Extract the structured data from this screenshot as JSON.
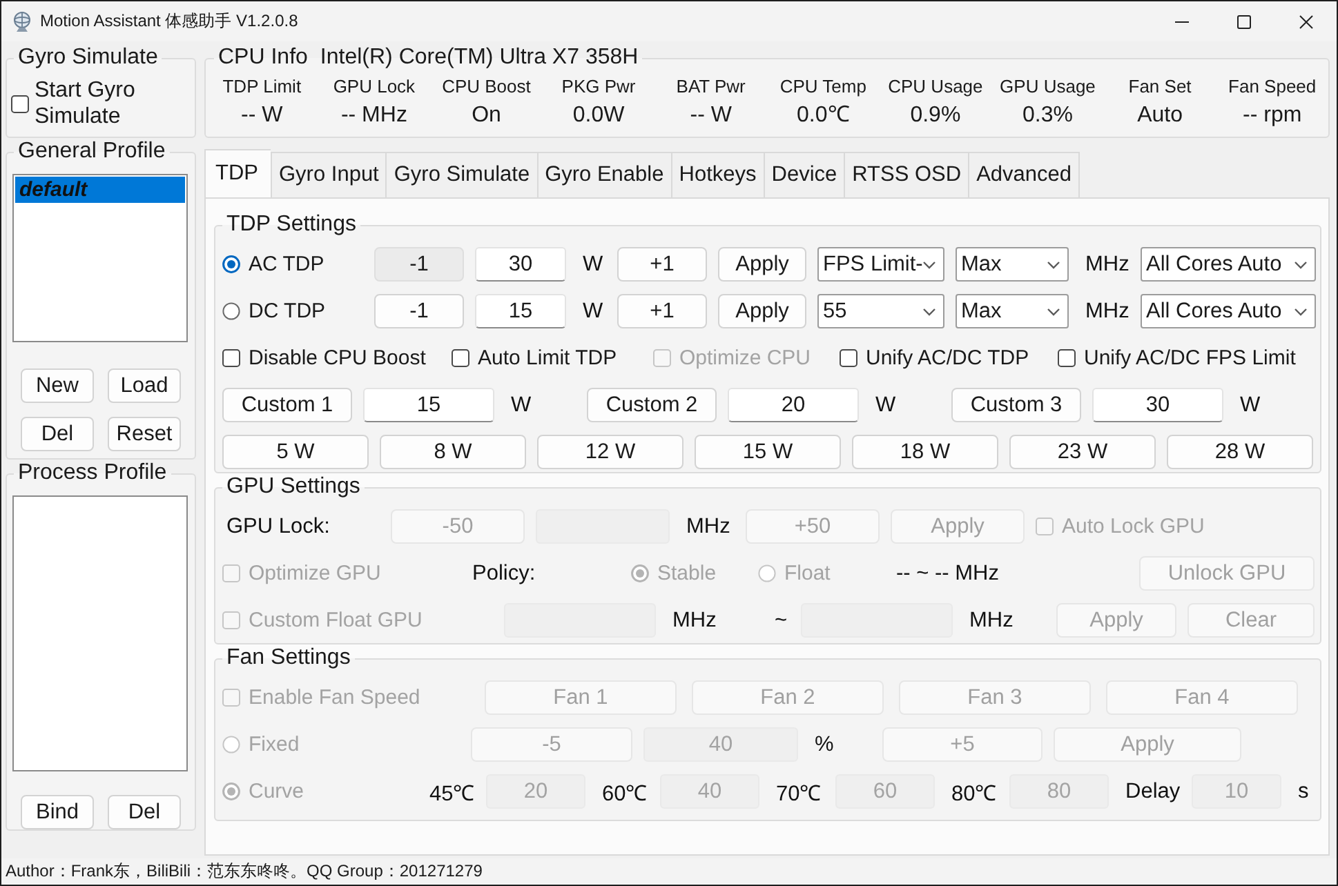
{
  "window": {
    "title": "Motion Assistant 体感助手 V1.2.0.8"
  },
  "gyro_simulate": {
    "title": "Gyro Simulate",
    "checkbox": {
      "label": "Start Gyro Simulate",
      "checked": false
    }
  },
  "cpu_info": {
    "title": "CPU Info",
    "processor": "Intel(R) Core(TM) Ultra X7 358H",
    "metrics": [
      {
        "label": "TDP Limit",
        "value": "-- W"
      },
      {
        "label": "GPU Lock",
        "value": "-- MHz"
      },
      {
        "label": "CPU Boost",
        "value": "On"
      },
      {
        "label": "PKG Pwr",
        "value": "0.0W"
      },
      {
        "label": "BAT Pwr",
        "value": "-- W"
      },
      {
        "label": "CPU Temp",
        "value": "0.0℃"
      },
      {
        "label": "CPU Usage",
        "value": "0.9%"
      },
      {
        "label": "GPU Usage",
        "value": "0.3%"
      },
      {
        "label": "Fan Set",
        "value": "Auto"
      },
      {
        "label": "Fan Speed",
        "value": "-- rpm"
      }
    ]
  },
  "general_profile": {
    "title": "General Profile",
    "items": [
      {
        "label": "default",
        "selected": true
      }
    ],
    "buttons": [
      "New",
      "Load",
      "Del",
      "Reset"
    ]
  },
  "process_profile": {
    "title": "Process Profile",
    "buttons": [
      "Bind",
      "Del"
    ]
  },
  "tabs": [
    {
      "label": "TDP",
      "selected": true
    },
    {
      "label": "Gyro Input",
      "selected": false
    },
    {
      "label": "Gyro Simulate",
      "selected": false
    },
    {
      "label": "Gyro Enable",
      "selected": false
    },
    {
      "label": "Hotkeys",
      "selected": false
    },
    {
      "label": "Device",
      "selected": false
    },
    {
      "label": "RTSS OSD",
      "selected": false
    },
    {
      "label": "Advanced",
      "selected": false
    }
  ],
  "tdp_settings": {
    "title": "TDP Settings",
    "lines": [
      {
        "controls": [
          {
            "kind": "radio",
            "label": "AC TDP",
            "selected": true,
            "disabled": false
          },
          {
            "kind": "button",
            "label": "-1",
            "hovered": true,
            "disabled": false
          },
          {
            "kind": "field",
            "value": "30",
            "disabled": false
          },
          {
            "kind": "label",
            "text": "W"
          },
          {
            "kind": "button",
            "label": "+1",
            "hovered": false,
            "disabled": false
          },
          {
            "kind": "button",
            "label": "Apply",
            "hovered": false,
            "disabled": false
          },
          {
            "kind": "combo",
            "value": "FPS Limit-",
            "disabled": false
          },
          {
            "kind": "combo",
            "value": "Max",
            "disabled": false
          },
          {
            "kind": "label",
            "text": "MHz"
          },
          {
            "kind": "combo",
            "value": "All Cores Auto",
            "disabled": false
          }
        ]
      },
      {
        "controls": [
          {
            "kind": "radio",
            "label": "DC TDP",
            "selected": false,
            "disabled": false
          },
          {
            "kind": "button",
            "label": "-1",
            "hovered": false,
            "disabled": false
          },
          {
            "kind": "field",
            "value": "15",
            "disabled": false
          },
          {
            "kind": "label",
            "text": "W"
          },
          {
            "kind": "button",
            "label": "+1",
            "hovered": false,
            "disabled": false
          },
          {
            "kind": "button",
            "label": "Apply",
            "hovered": false,
            "disabled": false
          },
          {
            "kind": "combo",
            "value": "55",
            "disabled": false
          },
          {
            "kind": "combo",
            "value": "Max",
            "disabled": false
          },
          {
            "kind": "label",
            "text": "MHz"
          },
          {
            "kind": "combo",
            "value": "All Cores Auto",
            "disabled": false
          }
        ]
      },
      {
        "controls": [
          {
            "kind": "checkbox",
            "label": "Disable CPU Boost",
            "checked": false,
            "disabled": false
          },
          {
            "kind": "checkbox",
            "label": "Auto Limit TDP",
            "checked": false,
            "disabled": false
          },
          {
            "kind": "checkbox",
            "label": "Optimize CPU",
            "checked": false,
            "disabled": true
          },
          {
            "kind": "checkbox",
            "label": "Unify AC/DC TDP",
            "checked": false,
            "disabled": false
          },
          {
            "kind": "checkbox",
            "label": "Unify AC/DC FPS Limit",
            "checked": false,
            "disabled": false
          }
        ]
      },
      {
        "controls": [
          {
            "kind": "button",
            "label": "Custom 1",
            "hovered": false,
            "disabled": false
          },
          {
            "kind": "field",
            "value": "15",
            "disabled": false
          },
          {
            "kind": "label",
            "text": "W"
          },
          {
            "kind": "button",
            "label": "Custom 2",
            "hovered": false,
            "disabled": false
          },
          {
            "kind": "field",
            "value": "20",
            "disabled": false
          },
          {
            "kind": "label",
            "text": "W"
          },
          {
            "kind": "button",
            "label": "Custom 3",
            "hovered": false,
            "disabled": false
          },
          {
            "kind": "field",
            "value": "30",
            "disabled": false
          },
          {
            "kind": "label",
            "text": "W"
          }
        ]
      },
      {
        "controls": [
          {
            "kind": "button",
            "label": "5 W",
            "hovered": false,
            "disabled": false
          },
          {
            "kind": "button",
            "label": "8 W",
            "hovered": false,
            "disabled": false
          },
          {
            "kind": "button",
            "label": "12 W",
            "hovered": false,
            "disabled": false
          },
          {
            "kind": "button",
            "label": "15 W",
            "hovered": false,
            "disabled": false
          },
          {
            "kind": "button",
            "label": "18 W",
            "hovered": false,
            "disabled": false
          },
          {
            "kind": "button",
            "label": "23 W",
            "hovered": false,
            "disabled": false
          },
          {
            "kind": "button",
            "label": "28 W",
            "hovered": false,
            "disabled": false
          }
        ]
      }
    ]
  },
  "gpu_settings": {
    "title": "GPU Settings",
    "lines": [
      {
        "controls": [
          {
            "kind": "label",
            "text": "GPU Lock:"
          },
          {
            "kind": "button",
            "label": "-50",
            "disabled": true
          },
          {
            "kind": "field",
            "disabled": true
          },
          {
            "kind": "label",
            "text": "MHz"
          },
          {
            "kind": "button",
            "label": "+50",
            "disabled": true
          },
          {
            "kind": "button",
            "label": "Apply",
            "disabled": true
          },
          {
            "kind": "checkbox",
            "label": "Auto Lock GPU",
            "checked": false,
            "disabled": true
          }
        ]
      },
      {
        "controls": [
          {
            "kind": "checkbox",
            "label": "Optimize GPU",
            "checked": false,
            "disabled": true
          },
          {
            "kind": "label",
            "text": "Policy:"
          },
          {
            "kind": "radio",
            "label": "Stable",
            "selected": true,
            "disabled": true
          },
          {
            "kind": "radio",
            "label": "Float",
            "selected": false,
            "disabled": true
          },
          {
            "kind": "label",
            "text": "-- ~ -- MHz"
          },
          {
            "kind": "button",
            "label": "Unlock GPU",
            "disabled": true
          }
        ]
      },
      {
        "controls": [
          {
            "kind": "checkbox",
            "label": "Custom Float GPU",
            "checked": false,
            "disabled": true
          },
          {
            "kind": "field",
            "disabled": true
          },
          {
            "kind": "label",
            "text": "MHz"
          },
          {
            "kind": "label",
            "text": "~"
          },
          {
            "kind": "field",
            "disabled": true
          },
          {
            "kind": "label",
            "text": "MHz"
          },
          {
            "kind": "button",
            "label": "Apply",
            "disabled": true
          },
          {
            "kind": "button",
            "label": "Clear",
            "disabled": true
          }
        ]
      }
    ]
  },
  "fan_settings": {
    "title": "Fan Settings",
    "lines": [
      {
        "controls": [
          {
            "kind": "checkbox",
            "label": "Enable Fan Speed",
            "checked": false,
            "disabled": true
          },
          {
            "kind": "button",
            "label": "Fan 1",
            "disabled": true
          },
          {
            "kind": "button",
            "label": "Fan 2",
            "disabled": true
          },
          {
            "kind": "button",
            "label": "Fan 3",
            "disabled": true
          },
          {
            "kind": "button",
            "label": "Fan 4",
            "disabled": true
          }
        ]
      },
      {
        "controls": [
          {
            "kind": "radio",
            "label": "Fixed",
            "selected": false,
            "disabled": true
          },
          {
            "kind": "button",
            "label": "-5",
            "disabled": true
          },
          {
            "kind": "field",
            "value": "40",
            "disabled": true
          },
          {
            "kind": "label",
            "text": "%"
          },
          {
            "kind": "button",
            "label": "+5",
            "disabled": true
          },
          {
            "kind": "button",
            "label": "Apply",
            "disabled": true
          }
        ]
      },
      {
        "controls": [
          {
            "kind": "radio",
            "label": "Curve",
            "selected": true,
            "disabled": true
          },
          {
            "kind": "label",
            "text": "45℃"
          },
          {
            "kind": "field",
            "value": "20",
            "disabled": true
          },
          {
            "kind": "label",
            "text": "60℃"
          },
          {
            "kind": "field",
            "value": "40",
            "disabled": true
          },
          {
            "kind": "label",
            "text": "70℃"
          },
          {
            "kind": "field",
            "value": "60",
            "disabled": true
          },
          {
            "kind": "label",
            "text": "80℃"
          },
          {
            "kind": "field",
            "value": "80",
            "disabled": true
          },
          {
            "kind": "label",
            "text": "Delay"
          },
          {
            "kind": "field",
            "value": "10",
            "disabled": true
          },
          {
            "kind": "label",
            "text": "s"
          }
        ]
      }
    ]
  },
  "status_bar": {
    "text": "Author：Frank东，BiliBili：范东东咚咚。QQ Group：201271279"
  }
}
